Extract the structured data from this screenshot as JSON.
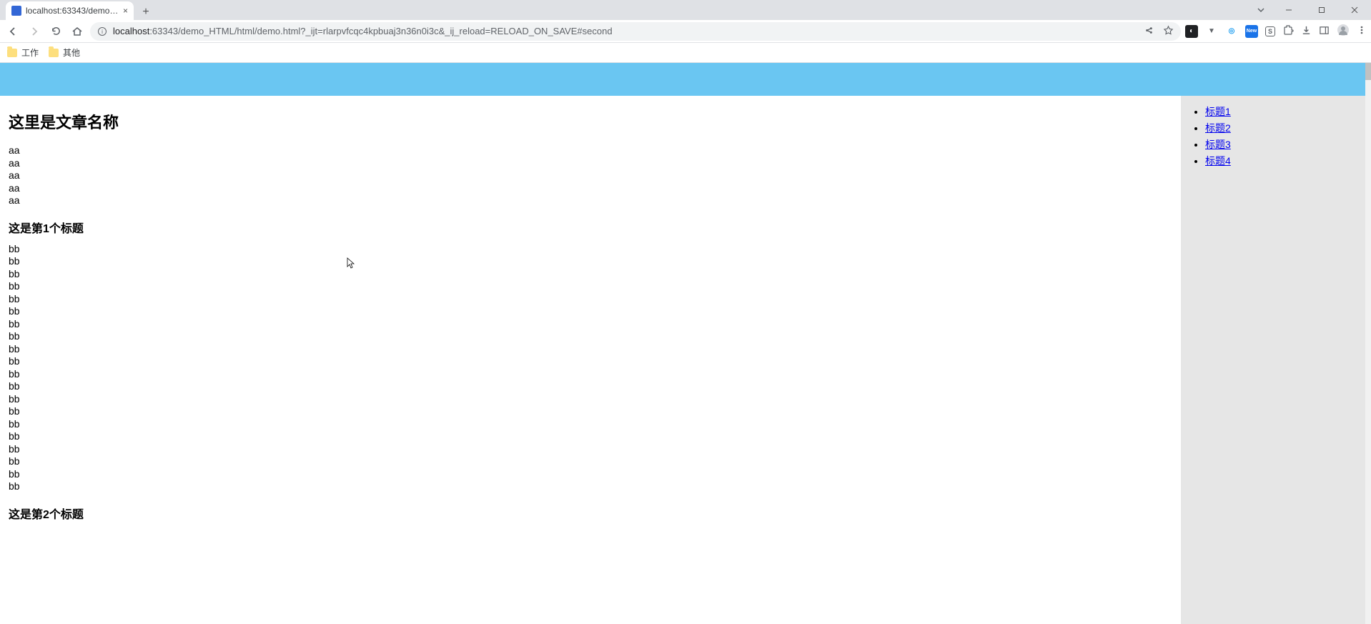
{
  "browser": {
    "tab_title": "localhost:63343/demo_HTML/",
    "url_host": "localhost",
    "url_rest": ":63343/demo_HTML/html/demo.html?_ijt=rlarpvfcqc4kpbuaj3n36n0i3c&_ij_reload=RELOAD_ON_SAVE#second",
    "bookmarks": [
      "工作",
      "其他"
    ]
  },
  "page": {
    "article_title": "这里是文章名称",
    "sections": [
      {
        "heading": null,
        "line_text": "aa",
        "line_count": 5
      },
      {
        "heading": "这是第1个标题",
        "line_text": "bb",
        "line_count": 20
      },
      {
        "heading": "这是第2个标题",
        "line_text": "",
        "line_count": 0
      }
    ],
    "nav_links": [
      "标题1",
      "标题2",
      "标题3",
      "标题4"
    ]
  }
}
